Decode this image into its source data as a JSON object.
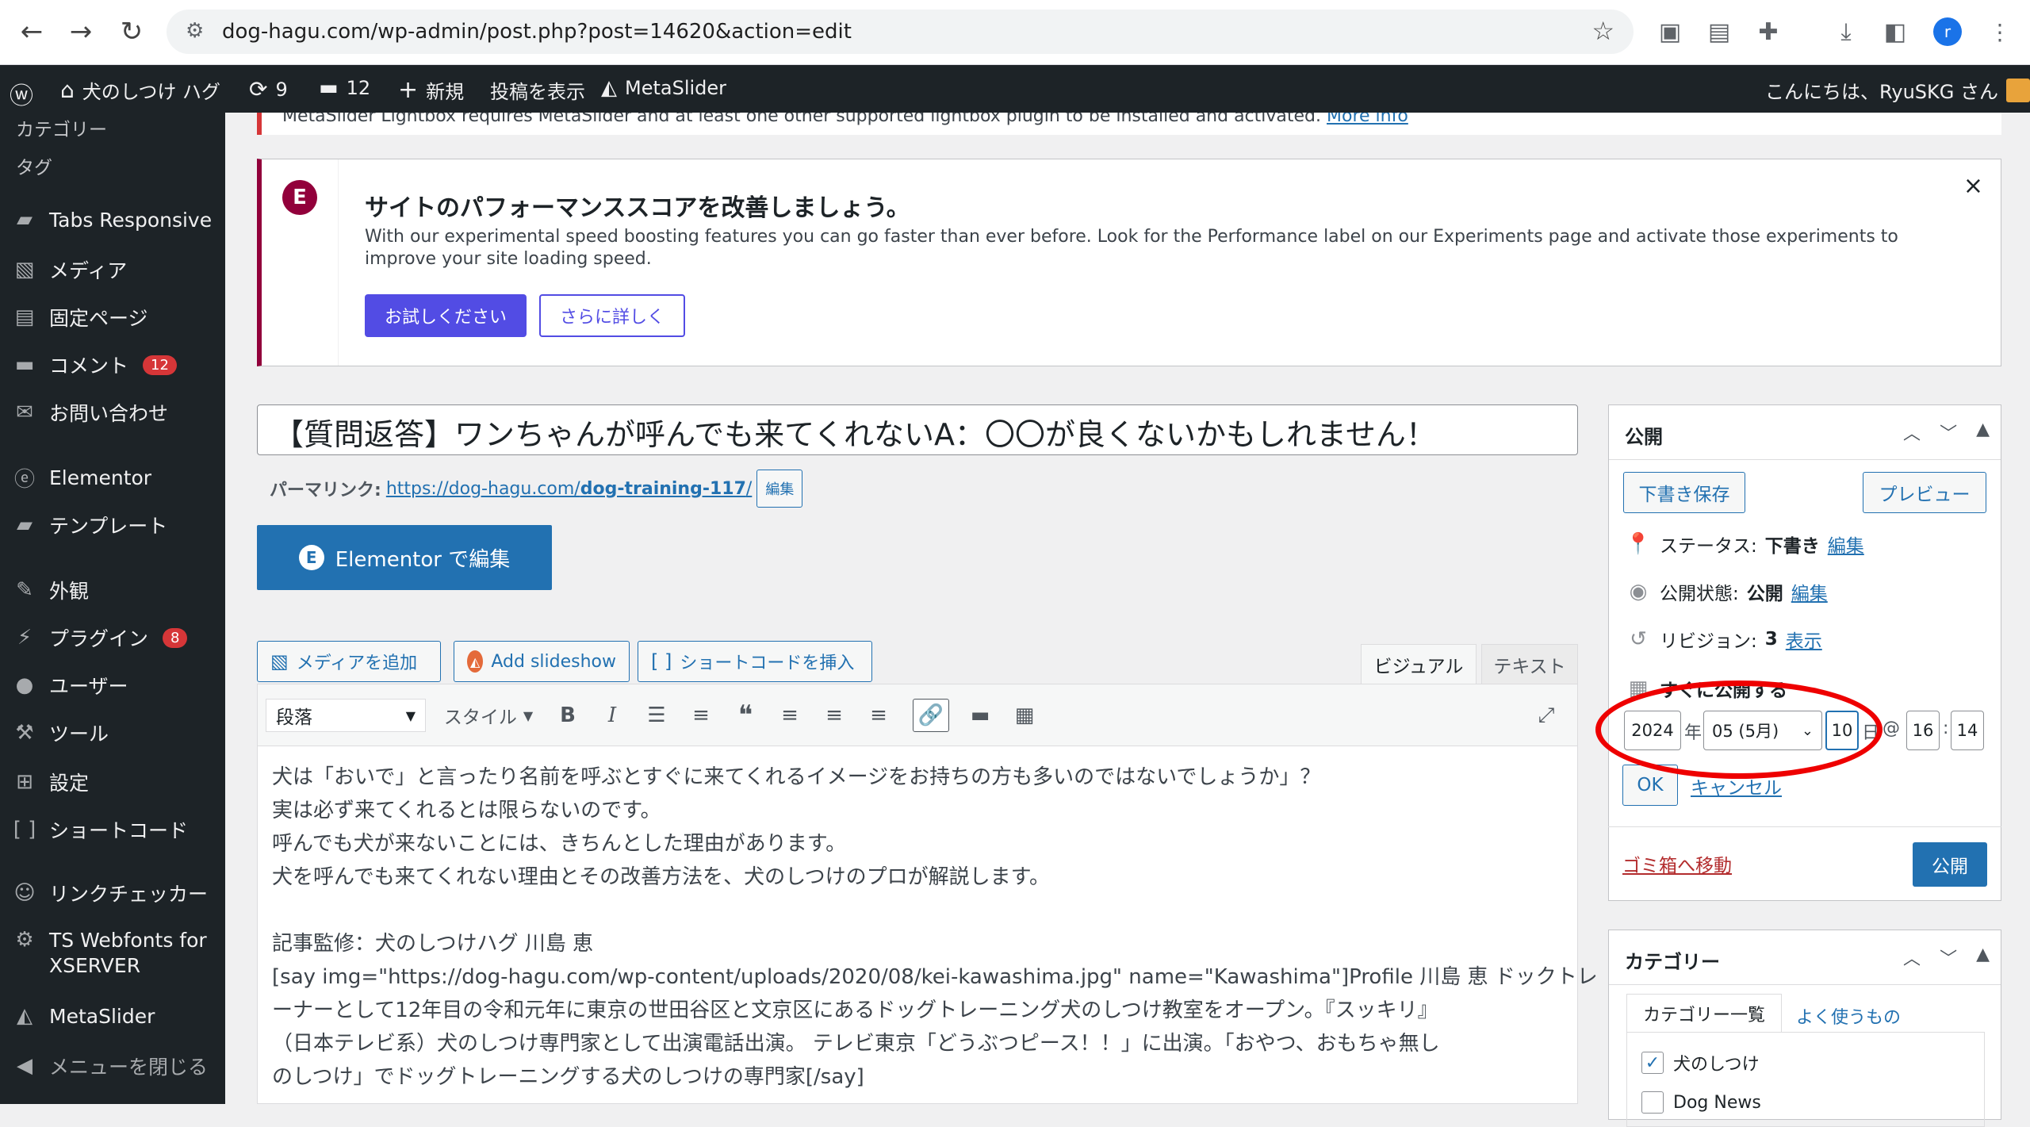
{
  "browser": {
    "url": "dog-hagu.com/wp-admin/post.php?post=14620&action=edit",
    "profile_initial": "r"
  },
  "adminbar": {
    "site_name": "犬のしつけ ハグ",
    "updates_count": "9",
    "comments_count": "12",
    "new_label": "新規",
    "view_post_label": "投稿を表示",
    "metaslider_label": "MetaSlider",
    "greeting": "こんにちは、RyuSKG さん"
  },
  "sidebar": {
    "sub_items": [
      "カテゴリー",
      "タグ"
    ],
    "items": [
      {
        "label": "Tabs Responsive",
        "icon": "folder-icon"
      },
      {
        "label": "メディア",
        "icon": "media-icon"
      },
      {
        "label": "固定ページ",
        "icon": "page-icon"
      },
      {
        "label": "コメント",
        "icon": "comment-icon",
        "badge": "12"
      },
      {
        "label": "お問い合わせ",
        "icon": "mail-icon"
      },
      {
        "label": "Elementor",
        "icon": "elementor-icon"
      },
      {
        "label": "テンプレート",
        "icon": "folder-icon"
      },
      {
        "label": "外観",
        "icon": "brush-icon"
      },
      {
        "label": "プラグイン",
        "icon": "plugin-icon",
        "badge": "8"
      },
      {
        "label": "ユーザー",
        "icon": "user-icon"
      },
      {
        "label": "ツール",
        "icon": "wrench-icon"
      },
      {
        "label": "設定",
        "icon": "settings-icon"
      },
      {
        "label": "ショートコード",
        "icon": "bracket-icon"
      },
      {
        "label": "リンクチェッカー",
        "icon": "link-checker-icon"
      },
      {
        "label": "TS Webfonts for XSERVER",
        "icon": "gear-icon"
      },
      {
        "label": "MetaSlider",
        "icon": "metaslider-icon"
      },
      {
        "label": "メニューを閉じる",
        "icon": "collapse-icon"
      }
    ]
  },
  "notice_top": {
    "text": "MetaSlider Lightbox requires MetaSlider and at least one other supported lightbox plugin to be installed and activated.",
    "link": "More info"
  },
  "perf_notice": {
    "title": "サイトのパフォーマンススコアを改善しましょう。",
    "text": "With our experimental speed boosting features you can go faster than ever before. Look for the Performance label on our Experiments page and activate those experiments to improve your site loading speed.",
    "try_button": "お試しください",
    "learn_button": "さらに詳しく"
  },
  "post": {
    "title": "【質問返答】ワンちゃんが呼んでも来てくれないA：〇〇が良くないかもしれません！",
    "permalink_label": "パーマリンク:",
    "permalink_base": "https://dog-hagu.com/",
    "permalink_slug": "dog-training-117",
    "permalink_end": "/",
    "permalink_edit": "編集",
    "elementor_button": "Elementor で編集"
  },
  "media_buttons": {
    "add_media": "メディアを追加",
    "add_slideshow": "Add slideshow",
    "insert_shortcode": "ショートコードを挿入"
  },
  "editor_tabs": {
    "visual": "ビジュアル",
    "text": "テキスト"
  },
  "toolbar": {
    "format": "段落",
    "style": "スタイル"
  },
  "content_lines": [
    "犬は「おいで」と言ったり名前を呼ぶとすぐに来てくれるイメージをお持ちの方も多いのではないでしょうか」？",
    "実は必ず来てくれるとは限らないのです。",
    "呼んでも犬が来ないことには、きちんとした理由があります。",
    "犬を呼んでも来てくれない理由とその改善方法を、犬のしつけのプロが解説します。",
    "",
    "記事監修：犬のしつけハグ 川島 恵",
    "[say img=\"https://dog-hagu.com/wp-content/uploads/2020/08/kei-kawashima.jpg\" name=\"Kawashima\"]Profile 川島 恵 ドックトレ",
    "ーナーとして12年目の令和元年に東京の世田谷区と文京区にあるドッグトレーニング犬のしつけ教室をオープン。『スッキリ』",
    "（日本テレビ系）犬のしつけ専門家として出演電話出演。 テレビ東京「どうぶつピース！！」に出演。「おやつ、おもちゃ無し",
    "のしつけ」でドッグトレーニングする犬のしつけの専門家[/say]"
  ],
  "publish": {
    "title": "公開",
    "save_draft": "下書き保存",
    "preview": "プレビュー",
    "status_label": "ステータス:",
    "status_value": "下書き",
    "visibility_label": "公開状態:",
    "visibility_value": "公開",
    "revisions_label": "リビジョン:",
    "revisions_value": "3",
    "edit_link": "編集",
    "show_link": "表示",
    "schedule_label": "すぐに公開する",
    "year": "2024",
    "year_suffix": "年",
    "month": "05 (5月)",
    "day": "10",
    "day_suffix": "日",
    "at": "@",
    "hour": "16",
    "colon": ":",
    "minute": "14",
    "ok": "OK",
    "cancel": "キャンセル",
    "trash": "ゴミ箱へ移動",
    "publish_button": "公開"
  },
  "categories": {
    "title": "カテゴリー",
    "tab_all": "カテゴリー一覧",
    "tab_popular": "よく使うもの",
    "items": [
      "犬のしつけ",
      "Dog News"
    ]
  }
}
